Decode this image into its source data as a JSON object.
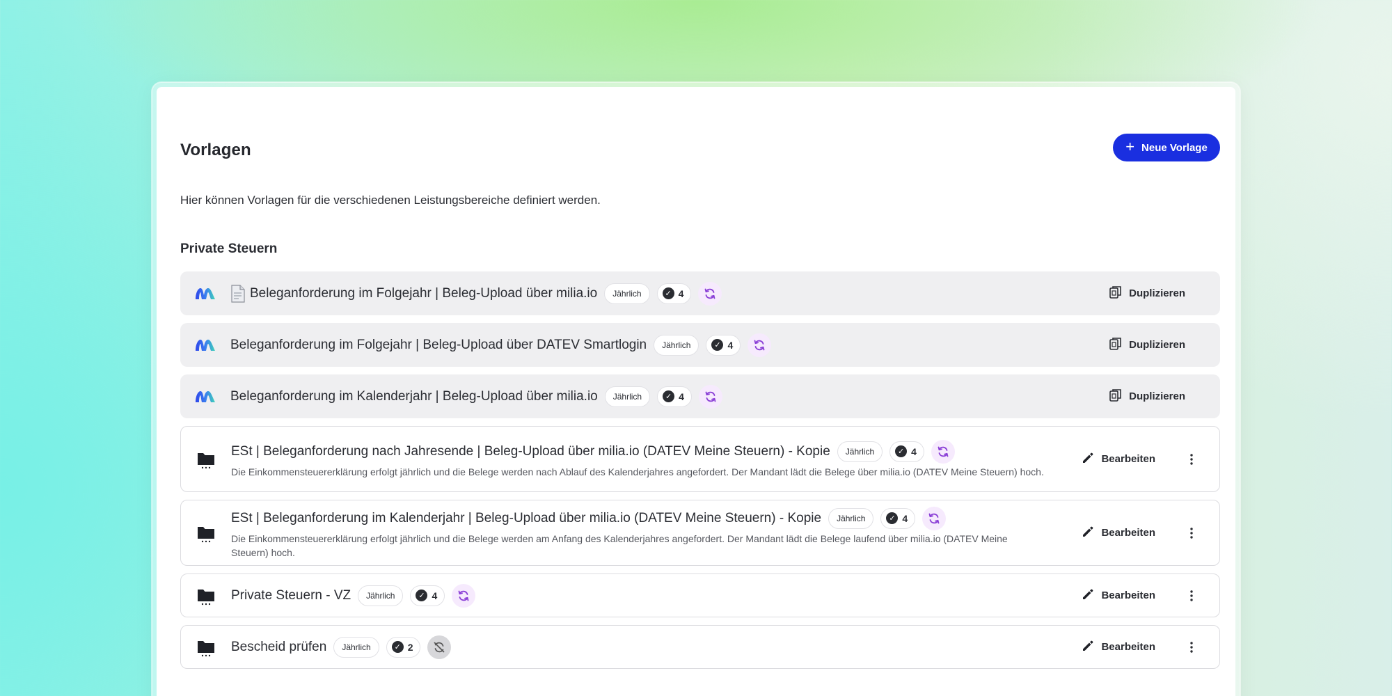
{
  "page": {
    "title": "Vorlagen",
    "description": "Hier können Vorlagen für die verschiedenen Leistungsbereiche definiert werden.",
    "new_button_label": "Neue Vorlage"
  },
  "section": {
    "title": "Private Steuern"
  },
  "actions": {
    "duplicate_label": "Duplizieren",
    "edit_label": "Bearbeiten"
  },
  "templates": [
    {
      "type": "system",
      "icon": "milia-logo-icon",
      "title": "Beleganforderung im Folgejahr | Beleg-Upload über milia.io",
      "has_doc_icon": true,
      "frequency": "Jährlich",
      "count": "4",
      "sync": "active"
    },
    {
      "type": "system",
      "icon": "milia-logo-icon",
      "title": "Beleganforderung im Folgejahr | Beleg-Upload über DATEV Smartlogin",
      "frequency": "Jährlich",
      "count": "4",
      "sync": "active"
    },
    {
      "type": "system",
      "icon": "milia-logo-icon",
      "title": "Beleganforderung im Kalenderjahr | Beleg-Upload über milia.io",
      "frequency": "Jährlich",
      "count": "4",
      "sync": "active"
    },
    {
      "type": "custom",
      "icon": "folder-icon",
      "title": "ESt | Beleganforderung nach Jahresende | Beleg-Upload über milia.io (DATEV Meine Steuern) - Kopie",
      "description": "Die Einkommensteuererklärung erfolgt jährlich und die Belege werden nach Ablauf des Kalenderjahres angefordert. Der Mandant lädt die Belege über milia.io (DATEV Meine Steuern) hoch.",
      "frequency": "Jährlich",
      "count": "4",
      "sync": "active"
    },
    {
      "type": "custom",
      "icon": "folder-icon",
      "title": "ESt | Beleganforderung im Kalenderjahr | Beleg-Upload über milia.io (DATEV Meine Steuern) - Kopie",
      "description": "Die Einkommensteuererklärung erfolgt jährlich und die Belege werden am Anfang des Kalenderjahres angefordert. Der Mandant lädt die Belege laufend über milia.io (DATEV Meine Steuern) hoch.",
      "frequency": "Jährlich",
      "count": "4",
      "sync": "active"
    },
    {
      "type": "custom",
      "icon": "folder-icon",
      "title": "Private Steuern - VZ",
      "frequency": "Jährlich",
      "count": "4",
      "sync": "active"
    },
    {
      "type": "custom",
      "icon": "folder-icon",
      "title": "Bescheid prüfen",
      "frequency": "Jährlich",
      "count": "2",
      "sync": "off"
    }
  ],
  "colors": {
    "primary": "#1a2fe0",
    "sync_bg": "#f6eafd",
    "sync_icon": "#8a3ed6",
    "system_row_bg": "#efeff1"
  }
}
